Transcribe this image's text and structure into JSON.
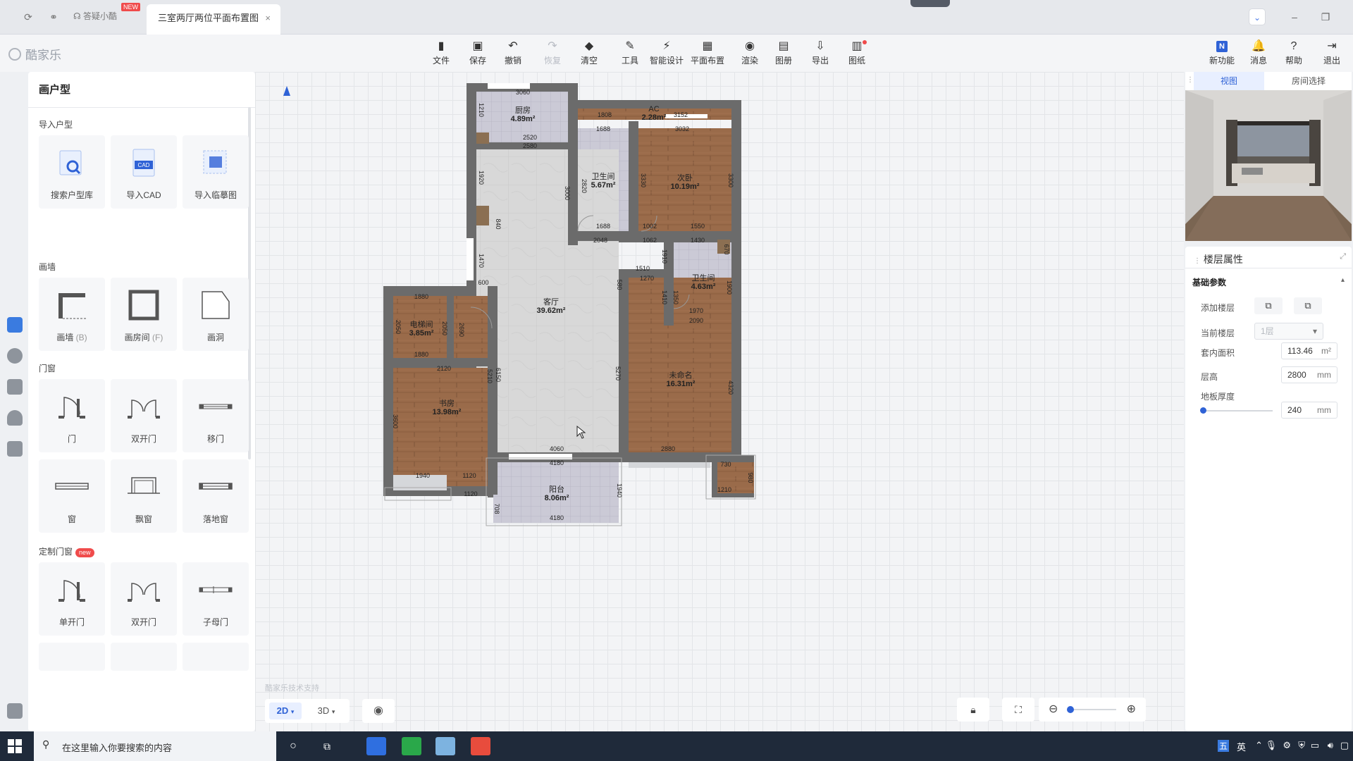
{
  "tabbar": {
    "help_label": "答疑小酷",
    "help_badge": "NEW",
    "active_tab": "三室两厅两位平面布置图",
    "close_glyph": "×"
  },
  "toolbar": {
    "logo": "酷家乐",
    "tools": [
      {
        "label": "文件",
        "icon": "file-icon",
        "glyph": "▮"
      },
      {
        "label": "保存",
        "icon": "save-icon",
        "glyph": "▣"
      },
      {
        "label": "撤销",
        "icon": "undo-icon",
        "glyph": "↶"
      },
      {
        "label": "恢复",
        "icon": "redo-icon",
        "glyph": "↷"
      },
      {
        "label": "清空",
        "icon": "eraser-icon",
        "glyph": "◆"
      },
      {
        "label": "工具",
        "icon": "wrench-icon",
        "glyph": "✎"
      },
      {
        "label": "智能设计",
        "icon": "lightning-icon",
        "glyph": "⚡"
      },
      {
        "label": "平面布置",
        "icon": "layout-icon",
        "glyph": "▦"
      },
      {
        "label": "渲染",
        "icon": "camera-icon",
        "glyph": "◉"
      },
      {
        "label": "图册",
        "icon": "album-icon",
        "glyph": "▤"
      },
      {
        "label": "导出",
        "icon": "export-icon",
        "glyph": "⇩"
      },
      {
        "label": "图纸",
        "icon": "drawing-icon",
        "glyph": "▥"
      }
    ],
    "right": [
      {
        "label": "新功能",
        "icon": "new-feature-icon",
        "glyph": "N"
      },
      {
        "label": "消息",
        "icon": "bell-icon",
        "glyph": "🔔"
      },
      {
        "label": "帮助",
        "icon": "help-icon",
        "glyph": "?"
      },
      {
        "label": "退出",
        "icon": "exit-icon",
        "glyph": "⇥"
      }
    ]
  },
  "left_panel": {
    "title": "画户型",
    "sections": {
      "import": "导入户型",
      "walls": "画墙",
      "doors": "门窗",
      "custom": "定制门窗",
      "custom_badge": "new"
    },
    "import_items": [
      "搜索户型库",
      "导入CAD",
      "导入临摹图"
    ],
    "cad_badge": "CAD",
    "wall_items": [
      {
        "label": "画墙",
        "key": "(B)"
      },
      {
        "label": "画房间",
        "key": "(F)"
      },
      {
        "label": "画洞",
        "key": ""
      }
    ],
    "door_items": [
      "门",
      "双开门",
      "移门",
      "窗",
      "飘窗",
      "落地窗"
    ],
    "custom_items": [
      "单开门",
      "双开门",
      "子母门"
    ]
  },
  "canvas": {
    "watermark": "酷家乐技术支持",
    "view_2d": "2D",
    "view_3d": "3D",
    "zoom_level": 0.05
  },
  "plan": {
    "rooms": [
      {
        "name": "厨房",
        "area": "4.89m²"
      },
      {
        "name": "AC",
        "area": "2.28m²"
      },
      {
        "name": "卫生间",
        "area": "5.67m²"
      },
      {
        "name": "次卧",
        "area": "10.19m²"
      },
      {
        "name": "卫生间",
        "area": "4.63m²"
      },
      {
        "name": "客厅",
        "area": "39.62m²"
      },
      {
        "name": "电梯间",
        "area": "3.85m²"
      },
      {
        "name": "书房",
        "area": "13.98m²"
      },
      {
        "name": "未命名",
        "area": "16.31m²"
      },
      {
        "name": "阳台",
        "area": "8.06m²"
      }
    ],
    "dims": [
      "3060",
      "1210",
      "2520",
      "2580",
      "1808",
      "3152",
      "1688",
      "3032",
      "1920",
      "3000",
      "2820",
      "3330",
      "3300",
      "1688",
      "1002",
      "1550",
      "2048",
      "1062",
      "1430",
      "670",
      "1510",
      "1270",
      "1910",
      "1470",
      "1900",
      "600",
      "1880",
      "2050",
      "2050",
      "1880",
      "2120",
      "2690",
      "5210",
      "6150",
      "5270",
      "4320",
      "1940",
      "1120",
      "4060",
      "4180",
      "2880",
      "730",
      "1210",
      "980",
      "1120",
      "4180",
      "1940",
      "708",
      "3600",
      "1410",
      "1350",
      "1970",
      "2090",
      "840",
      "580"
    ]
  },
  "right_panel": {
    "tab_view": "视图",
    "tab_room": "房间选择",
    "props_title": "楼层属性",
    "basic_title": "基础参数",
    "rows": {
      "add_floor": "添加楼层",
      "current_floor": "当前楼层",
      "current_floor_value": "1层",
      "area": "套内面积",
      "area_value": "113.46",
      "area_unit": "m²",
      "height": "层高",
      "height_value": "2800",
      "height_unit": "mm",
      "thickness": "地板厚度",
      "thickness_value": "240",
      "thickness_unit": "mm"
    },
    "thickness_slider": 0.0
  },
  "taskbar": {
    "search_placeholder": "在这里输入你要搜索的内容",
    "ime_a": "五",
    "ime_b": "英"
  },
  "colors": {
    "accent": "#2f62d6",
    "wall": "#6b6b6b",
    "wood": "#9a6b4a",
    "tile": "#c9c9d2",
    "living": "#d7d7d7"
  }
}
